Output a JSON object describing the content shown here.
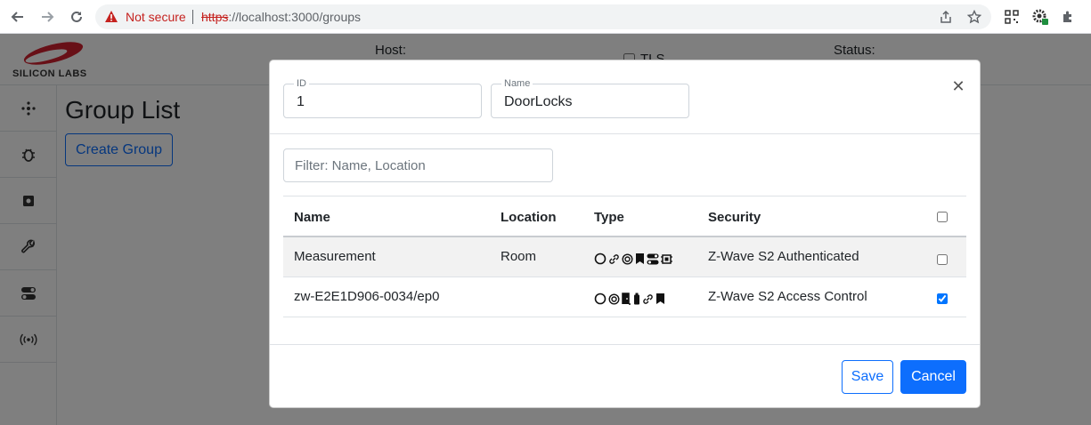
{
  "browser": {
    "security_label": "Not secure",
    "url_scheme": "https",
    "url_rest": "://localhost:3000/groups"
  },
  "app": {
    "logo_text": "SILICON LABS",
    "host_label": "Host:",
    "tls_label": "TLS",
    "status_label": "Status:",
    "sidebar_icons": [
      "network-icon",
      "bug-icon",
      "chip-icon",
      "wrench-icon",
      "toggle-icon",
      "broadcast-icon"
    ],
    "page_title": "Group List",
    "create_button": "Create Group"
  },
  "modal": {
    "id_label": "ID",
    "id_value": "1",
    "name_label": "Name",
    "name_value": "DoorLocks",
    "filter_placeholder": "Filter: Name, Location",
    "columns": {
      "name": "Name",
      "location": "Location",
      "type": "Type",
      "security": "Security"
    },
    "rows": [
      {
        "name": "Measurement",
        "location": "Room",
        "type_icons": [
          "circle-icon",
          "link-icon",
          "target-icon",
          "bookmark-icon",
          "toggle-icon",
          "chip-icon"
        ],
        "security": "Z-Wave S2 Authenticated",
        "checked": false
      },
      {
        "name": "zw-E2E1D906-0034/ep0",
        "location": "",
        "type_icons": [
          "circle-icon",
          "target-icon",
          "door-icon",
          "battery-icon",
          "link-icon",
          "bookmark-icon"
        ],
        "security": "Z-Wave S2 Access Control",
        "checked": true
      }
    ],
    "save_button": "Save",
    "cancel_button": "Cancel"
  },
  "colors": {
    "accent": "#0d6efd",
    "not_secure": "#c5221f",
    "backdrop": "rgba(0,0,0,0.5)",
    "logo_red": "#d0202e"
  }
}
